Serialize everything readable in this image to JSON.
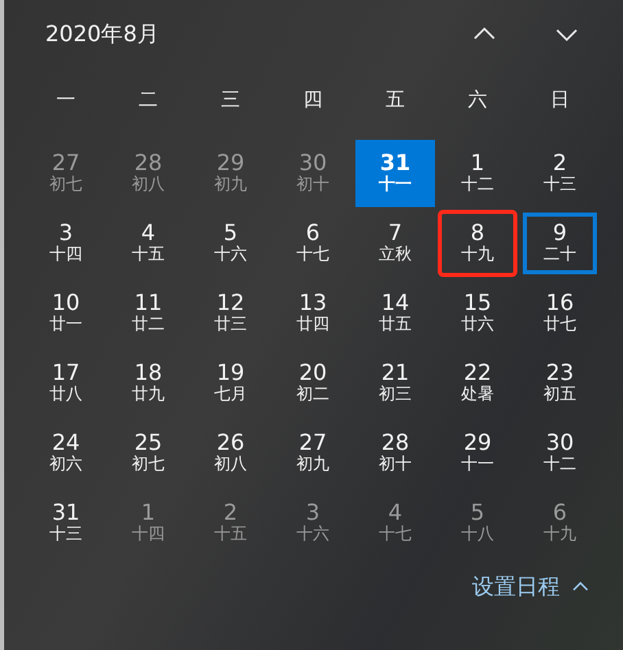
{
  "header": {
    "title": "2020年8月"
  },
  "weekdays": [
    "一",
    "二",
    "三",
    "四",
    "五",
    "六",
    "日"
  ],
  "days": [
    {
      "day": "27",
      "lunar": "初七",
      "in_month": false,
      "today": false,
      "selected": false,
      "marked": false
    },
    {
      "day": "28",
      "lunar": "初八",
      "in_month": false,
      "today": false,
      "selected": false,
      "marked": false
    },
    {
      "day": "29",
      "lunar": "初九",
      "in_month": false,
      "today": false,
      "selected": false,
      "marked": false
    },
    {
      "day": "30",
      "lunar": "初十",
      "in_month": false,
      "today": false,
      "selected": false,
      "marked": false
    },
    {
      "day": "31",
      "lunar": "十一",
      "in_month": false,
      "today": true,
      "selected": false,
      "marked": false
    },
    {
      "day": "1",
      "lunar": "十二",
      "in_month": true,
      "today": false,
      "selected": false,
      "marked": false
    },
    {
      "day": "2",
      "lunar": "十三",
      "in_month": true,
      "today": false,
      "selected": false,
      "marked": false
    },
    {
      "day": "3",
      "lunar": "十四",
      "in_month": true,
      "today": false,
      "selected": false,
      "marked": false
    },
    {
      "day": "4",
      "lunar": "十五",
      "in_month": true,
      "today": false,
      "selected": false,
      "marked": false
    },
    {
      "day": "5",
      "lunar": "十六",
      "in_month": true,
      "today": false,
      "selected": false,
      "marked": false
    },
    {
      "day": "6",
      "lunar": "十七",
      "in_month": true,
      "today": false,
      "selected": false,
      "marked": false
    },
    {
      "day": "7",
      "lunar": "立秋",
      "in_month": true,
      "today": false,
      "selected": false,
      "marked": false
    },
    {
      "day": "8",
      "lunar": "十九",
      "in_month": true,
      "today": false,
      "selected": false,
      "marked": true
    },
    {
      "day": "9",
      "lunar": "二十",
      "in_month": true,
      "today": false,
      "selected": true,
      "marked": false
    },
    {
      "day": "10",
      "lunar": "廿一",
      "in_month": true,
      "today": false,
      "selected": false,
      "marked": false
    },
    {
      "day": "11",
      "lunar": "廿二",
      "in_month": true,
      "today": false,
      "selected": false,
      "marked": false
    },
    {
      "day": "12",
      "lunar": "廿三",
      "in_month": true,
      "today": false,
      "selected": false,
      "marked": false
    },
    {
      "day": "13",
      "lunar": "廿四",
      "in_month": true,
      "today": false,
      "selected": false,
      "marked": false
    },
    {
      "day": "14",
      "lunar": "廿五",
      "in_month": true,
      "today": false,
      "selected": false,
      "marked": false
    },
    {
      "day": "15",
      "lunar": "廿六",
      "in_month": true,
      "today": false,
      "selected": false,
      "marked": false
    },
    {
      "day": "16",
      "lunar": "廿七",
      "in_month": true,
      "today": false,
      "selected": false,
      "marked": false
    },
    {
      "day": "17",
      "lunar": "廿八",
      "in_month": true,
      "today": false,
      "selected": false,
      "marked": false
    },
    {
      "day": "18",
      "lunar": "廿九",
      "in_month": true,
      "today": false,
      "selected": false,
      "marked": false
    },
    {
      "day": "19",
      "lunar": "七月",
      "in_month": true,
      "today": false,
      "selected": false,
      "marked": false
    },
    {
      "day": "20",
      "lunar": "初二",
      "in_month": true,
      "today": false,
      "selected": false,
      "marked": false
    },
    {
      "day": "21",
      "lunar": "初三",
      "in_month": true,
      "today": false,
      "selected": false,
      "marked": false
    },
    {
      "day": "22",
      "lunar": "处暑",
      "in_month": true,
      "today": false,
      "selected": false,
      "marked": false
    },
    {
      "day": "23",
      "lunar": "初五",
      "in_month": true,
      "today": false,
      "selected": false,
      "marked": false
    },
    {
      "day": "24",
      "lunar": "初六",
      "in_month": true,
      "today": false,
      "selected": false,
      "marked": false
    },
    {
      "day": "25",
      "lunar": "初七",
      "in_month": true,
      "today": false,
      "selected": false,
      "marked": false
    },
    {
      "day": "26",
      "lunar": "初八",
      "in_month": true,
      "today": false,
      "selected": false,
      "marked": false
    },
    {
      "day": "27",
      "lunar": "初九",
      "in_month": true,
      "today": false,
      "selected": false,
      "marked": false
    },
    {
      "day": "28",
      "lunar": "初十",
      "in_month": true,
      "today": false,
      "selected": false,
      "marked": false
    },
    {
      "day": "29",
      "lunar": "十一",
      "in_month": true,
      "today": false,
      "selected": false,
      "marked": false
    },
    {
      "day": "30",
      "lunar": "十二",
      "in_month": true,
      "today": false,
      "selected": false,
      "marked": false
    },
    {
      "day": "31",
      "lunar": "十三",
      "in_month": true,
      "today": false,
      "selected": false,
      "marked": false
    },
    {
      "day": "1",
      "lunar": "十四",
      "in_month": false,
      "today": false,
      "selected": false,
      "marked": false
    },
    {
      "day": "2",
      "lunar": "十五",
      "in_month": false,
      "today": false,
      "selected": false,
      "marked": false
    },
    {
      "day": "3",
      "lunar": "十六",
      "in_month": false,
      "today": false,
      "selected": false,
      "marked": false
    },
    {
      "day": "4",
      "lunar": "十七",
      "in_month": false,
      "today": false,
      "selected": false,
      "marked": false
    },
    {
      "day": "5",
      "lunar": "十八",
      "in_month": false,
      "today": false,
      "selected": false,
      "marked": false
    },
    {
      "day": "6",
      "lunar": "十九",
      "in_month": false,
      "today": false,
      "selected": false,
      "marked": false
    }
  ],
  "footer": {
    "link": "设置日程"
  }
}
